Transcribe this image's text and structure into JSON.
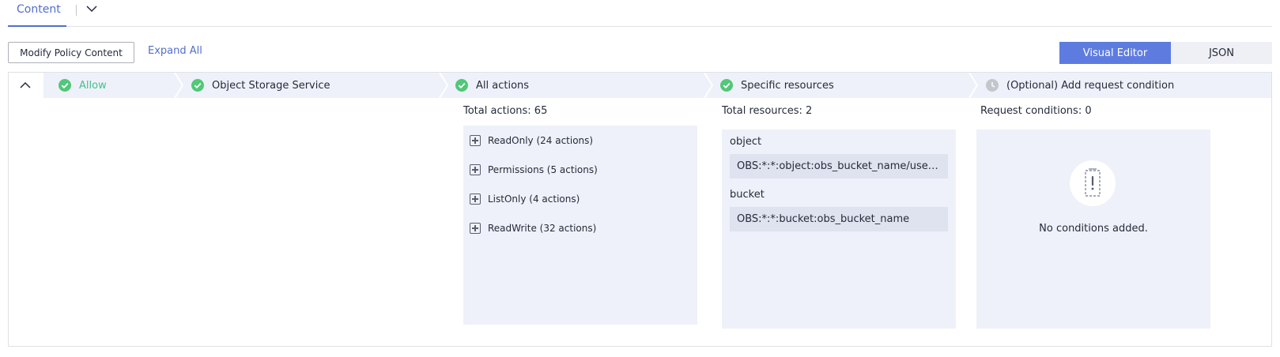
{
  "tabs": {
    "active_label": "Content"
  },
  "toolbar": {
    "modify_label": "Modify Policy Content",
    "expand_label": "Expand All"
  },
  "editor_switch": {
    "visual_label": "Visual Editor",
    "json_label": "JSON",
    "selected": "Visual Editor"
  },
  "steps": [
    {
      "label": "Allow",
      "icon": "check-circle-icon",
      "status": "done"
    },
    {
      "label": "Object Storage Service",
      "icon": "check-circle-icon",
      "status": "done"
    },
    {
      "label": "All actions",
      "icon": "check-circle-icon",
      "status": "done"
    },
    {
      "label": "Specific resources",
      "icon": "check-circle-icon",
      "status": "done"
    },
    {
      "label": "(Optional) Add request condition",
      "icon": "clock-icon",
      "status": "pending"
    }
  ],
  "actions": {
    "total_label": "Total actions: 65",
    "groups": [
      {
        "label": "ReadOnly (24 actions)"
      },
      {
        "label": "Permissions (5 actions)"
      },
      {
        "label": "ListOnly (4 actions)"
      },
      {
        "label": "ReadWrite (32 actions)"
      }
    ]
  },
  "resources": {
    "total_label": "Total resources: 2",
    "items": [
      {
        "type": "object",
        "value": "OBS:*:*:object:obs_bucket_name/user/roo..."
      },
      {
        "type": "bucket",
        "value": "OBS:*:*:bucket:obs_bucket_name"
      }
    ]
  },
  "conditions": {
    "total_label": "Request conditions: 0",
    "empty_text": "No conditions added."
  },
  "colors": {
    "accent": "#5e7ce0",
    "link": "#526ecc",
    "success": "#50c878",
    "panel_bg": "#eef1f9"
  }
}
